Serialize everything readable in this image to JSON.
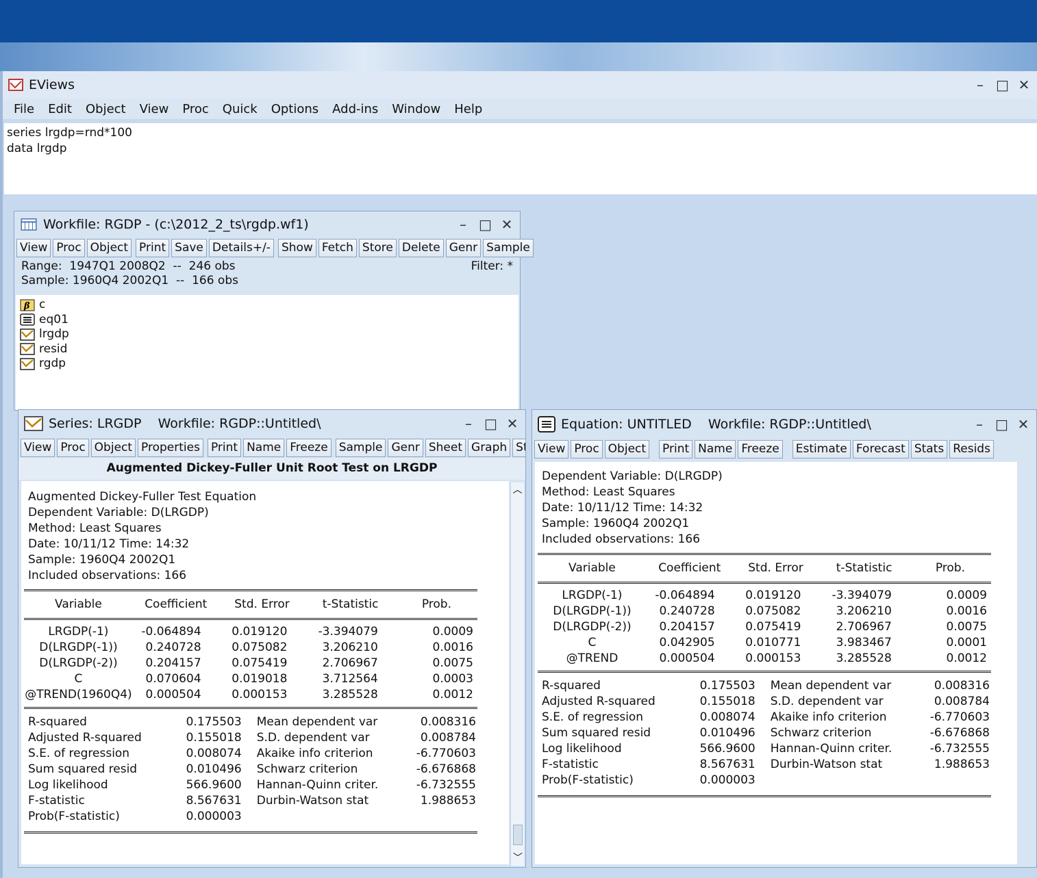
{
  "app": {
    "title": "EViews",
    "menu": [
      "File",
      "Edit",
      "Object",
      "View",
      "Proc",
      "Quick",
      "Options",
      "Add-ins",
      "Window",
      "Help"
    ],
    "commands": [
      "series lrgdp=rnd*100",
      "data lrgdp"
    ]
  },
  "workfile": {
    "title": "Workfile: RGDP - (c:\\2012_2_ts\\rgdp.wf1)",
    "toolbar": [
      "View",
      "Proc",
      "Object",
      "|",
      "Print",
      "Save",
      "Details+/-",
      "|",
      "Show",
      "Fetch",
      "Store",
      "Delete",
      "Genr",
      "Sample"
    ],
    "range": "Range:  1947Q1 2008Q2  --  246 obs",
    "sample": "Sample: 1960Q4 2002Q1  --  166 obs",
    "filter": "Filter: *",
    "objects": [
      {
        "name": "c",
        "icon": "beta-icon"
      },
      {
        "name": "eq01",
        "icon": "equation-icon"
      },
      {
        "name": "lrgdp",
        "icon": "series-icon"
      },
      {
        "name": "resid",
        "icon": "series-icon"
      },
      {
        "name": "rgdp",
        "icon": "series-icon"
      }
    ]
  },
  "series_win": {
    "title": "Series: LRGDP    Workfile: RGDP::Untitled\\",
    "toolbar": [
      "View",
      "Proc",
      "Object",
      "Properties",
      "|",
      "Print",
      "Name",
      "Freeze",
      "|",
      "Sample",
      "Genr",
      "Sheet",
      "Graph",
      "Stats",
      "I"
    ],
    "header": "Augmented Dickey-Fuller Unit Root Test on LRGDP",
    "info": [
      "Augmented Dickey-Fuller Test Equation",
      "Dependent Variable: D(LRGDP)",
      "Method: Least Squares",
      "Date: 10/11/12   Time: 14:32",
      "Sample: 1960Q4 2002Q1",
      "Included observations: 166"
    ],
    "cols": [
      "Variable",
      "Coefficient",
      "Std. Error",
      "t-Statistic",
      "Prob."
    ],
    "rows": [
      [
        "LRGDP(-1)",
        "-0.064894",
        "0.019120",
        "-3.394079",
        "0.0009"
      ],
      [
        "D(LRGDP(-1))",
        "0.240728",
        "0.075082",
        "3.206210",
        "0.0016"
      ],
      [
        "D(LRGDP(-2))",
        "0.204157",
        "0.075419",
        "2.706967",
        "0.0075"
      ],
      [
        "C",
        "0.070604",
        "0.019018",
        "3.712564",
        "0.0003"
      ],
      [
        "@TREND(1960Q4)",
        "0.000504",
        "0.000153",
        "3.285528",
        "0.0012"
      ]
    ],
    "stats": [
      [
        "R-squared",
        "0.175503",
        "Mean dependent var",
        "0.008316"
      ],
      [
        "Adjusted R-squared",
        "0.155018",
        "S.D. dependent var",
        "0.008784"
      ],
      [
        "S.E. of regression",
        "0.008074",
        "Akaike info criterion",
        "-6.770603"
      ],
      [
        "Sum squared resid",
        "0.010496",
        "Schwarz criterion",
        "-6.676868"
      ],
      [
        "Log likelihood",
        "566.9600",
        "Hannan-Quinn criter.",
        "-6.732555"
      ],
      [
        "F-statistic",
        "8.567631",
        "Durbin-Watson stat",
        "1.988653"
      ],
      [
        "Prob(F-statistic)",
        "0.000003",
        "",
        ""
      ]
    ]
  },
  "eq_win": {
    "title": "Equation: UNTITLED    Workfile: RGDP::Untitled\\",
    "toolbar": [
      "View",
      "Proc",
      "Object",
      "|",
      "Print",
      "Name",
      "Freeze",
      "|",
      "Estimate",
      "Forecast",
      "Stats",
      "Resids"
    ],
    "info": [
      "Dependent Variable: D(LRGDP)",
      "Method: Least Squares",
      "Date: 10/11/12   Time: 14:32",
      "Sample: 1960Q4 2002Q1",
      "Included observations: 166"
    ],
    "cols": [
      "Variable",
      "Coefficient",
      "Std. Error",
      "t-Statistic",
      "Prob."
    ],
    "rows": [
      [
        "LRGDP(-1)",
        "-0.064894",
        "0.019120",
        "-3.394079",
        "0.0009"
      ],
      [
        "D(LRGDP(-1))",
        "0.240728",
        "0.075082",
        "3.206210",
        "0.0016"
      ],
      [
        "D(LRGDP(-2))",
        "0.204157",
        "0.075419",
        "2.706967",
        "0.0075"
      ],
      [
        "C",
        "0.042905",
        "0.010771",
        "3.983467",
        "0.0001"
      ],
      [
        "@TREND",
        "0.000504",
        "0.000153",
        "3.285528",
        "0.0012"
      ]
    ],
    "stats": [
      [
        "R-squared",
        "0.175503",
        "Mean dependent var",
        "0.008316"
      ],
      [
        "Adjusted R-squared",
        "0.155018",
        "S.D. dependent var",
        "0.008784"
      ],
      [
        "S.E. of regression",
        "0.008074",
        "Akaike info criterion",
        "-6.770603"
      ],
      [
        "Sum squared resid",
        "0.010496",
        "Schwarz criterion",
        "-6.676868"
      ],
      [
        "Log likelihood",
        "566.9600",
        "Hannan-Quinn criter.",
        "-6.732555"
      ],
      [
        "F-statistic",
        "8.567631",
        "Durbin-Watson stat",
        "1.988653"
      ],
      [
        "Prob(F-statistic)",
        "0.000003",
        "",
        ""
      ]
    ]
  },
  "colors": {
    "titlebar": "#0c4c9a",
    "window": "#d7e4f2",
    "icon_accent": "#c0392b"
  }
}
